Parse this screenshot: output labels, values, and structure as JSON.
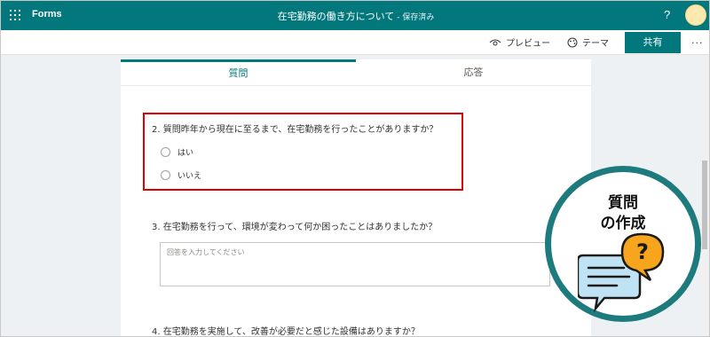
{
  "app": {
    "name": "Forms"
  },
  "document": {
    "title": "在宅勤務の働き方について",
    "saved_status": "- 保存済み"
  },
  "header": {
    "help": "?"
  },
  "toolbar": {
    "preview_label": "プレビュー",
    "theme_label": "テーマ",
    "share_label": "共有",
    "more": "···"
  },
  "tabs": [
    {
      "label": "質問",
      "active": true
    },
    {
      "label": "応答",
      "active": false
    }
  ],
  "questions": [
    {
      "title": "2. 質問昨年から現在に至るまで、在宅勤務を行ったことがありますか？",
      "options": [
        "はい",
        "いいえ"
      ]
    },
    {
      "title": "3. 在宅勤務を行って、環境が変わって何か困ったことはありましたか？",
      "placeholder": "回答を入力してください"
    },
    {
      "title": "4. 在宅勤務を実施して、改善が必要だと感じた設備はありますか？"
    }
  ],
  "badge": {
    "line1": "質問",
    "line2": "の作成",
    "icon_text": "?"
  },
  "colors": {
    "brand": "#03787c",
    "highlight_border": "#e00000",
    "badge_ring": "#1d7b7e",
    "bubble_orange": "#f6a51c",
    "bubble_blue": "#bfe3f5"
  },
  "icons": [
    "waffle-icon",
    "help-icon",
    "eye-icon",
    "palette-icon",
    "more-icon",
    "question-bubble-icon",
    "chat-bubble-icon"
  ]
}
